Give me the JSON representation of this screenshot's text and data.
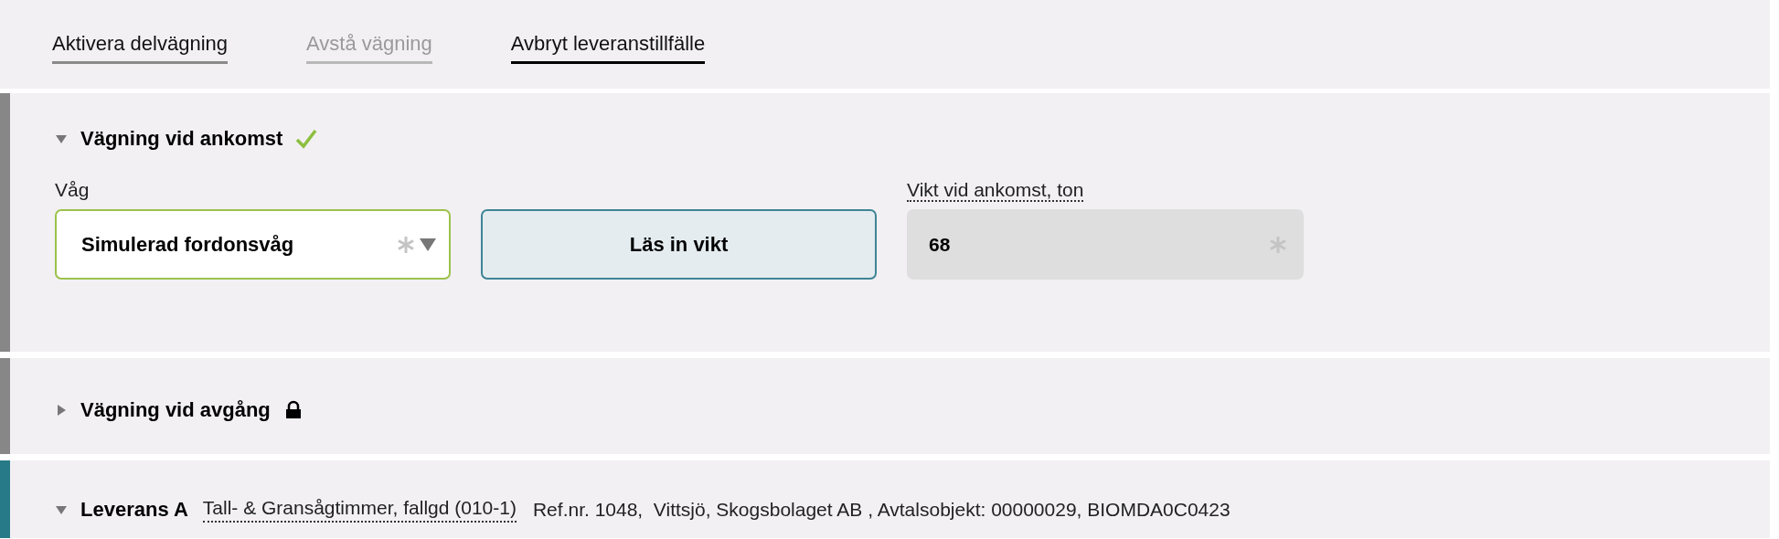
{
  "actions": [
    {
      "label": "Aktivera delvägning",
      "disabled": false,
      "hovered": false
    },
    {
      "label": "Avstå vägning",
      "disabled": true
    },
    {
      "label": "Avbryt leveranstillfälle",
      "disabled": false,
      "hovered": true
    }
  ],
  "sections": [
    {
      "kind": "weighing",
      "title": "Vägning vid ankomst",
      "expanded": true,
      "done": true,
      "color": "#878787",
      "scale": {
        "label": "Våg",
        "value": "Simulerad fordonsvåg",
        "required": true
      },
      "read_button": "Läs in vikt",
      "weight": {
        "label": "Vikt vid ankomst, ton",
        "value": "68",
        "required": true,
        "disabled": true
      }
    },
    {
      "kind": "weighing",
      "title": "Vägning vid avgång",
      "expanded": false,
      "locked": true,
      "color": "#878787"
    },
    {
      "kind": "delivery",
      "title": "Leverans A",
      "expanded": true,
      "color": "#277a87",
      "product": "Tall- & Gransågtimmer, fallgd (010-1)",
      "details": "Ref.nr. 1048,  Vittsjö, Skogsbolaget AB , Avtalsobjekt: 00000029, BIOMDA0C0423"
    }
  ]
}
